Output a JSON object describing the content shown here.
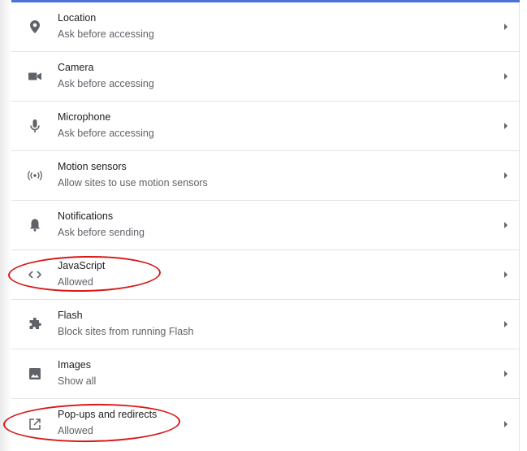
{
  "settings": {
    "items": [
      {
        "title": "Location",
        "subtitle": "Ask before accessing",
        "icon": "location-pin-icon"
      },
      {
        "title": "Camera",
        "subtitle": "Ask before accessing",
        "icon": "camera-icon"
      },
      {
        "title": "Microphone",
        "subtitle": "Ask before accessing",
        "icon": "microphone-icon"
      },
      {
        "title": "Motion sensors",
        "subtitle": "Allow sites to use motion sensors",
        "icon": "motion-sensors-icon"
      },
      {
        "title": "Notifications",
        "subtitle": "Ask before sending",
        "icon": "bell-icon"
      },
      {
        "title": "JavaScript",
        "subtitle": "Allowed",
        "icon": "code-brackets-icon"
      },
      {
        "title": "Flash",
        "subtitle": "Block sites from running Flash",
        "icon": "puzzle-piece-icon"
      },
      {
        "title": "Images",
        "subtitle": "Show all",
        "icon": "image-icon"
      },
      {
        "title": "Pop-ups and redirects",
        "subtitle": "Allowed",
        "icon": "open-in-new-icon"
      }
    ]
  },
  "colors": {
    "accent_line": "#4a72d8",
    "annotation": "#d91818",
    "icon": "#5f6368",
    "title": "#202124",
    "subtitle": "#5f6368"
  }
}
